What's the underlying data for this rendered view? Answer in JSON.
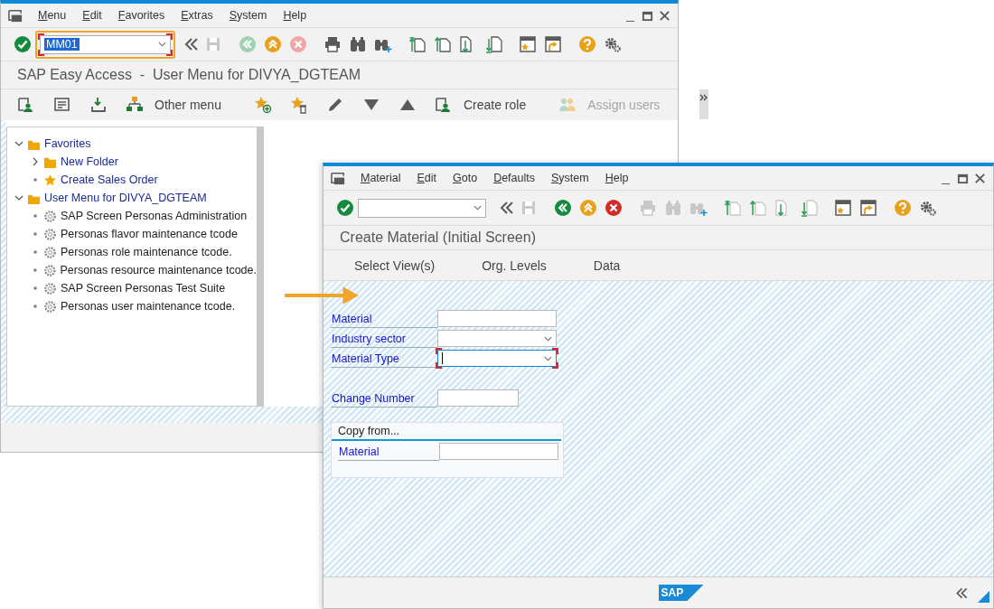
{
  "window_main": {
    "menu": [
      "Menu",
      "Edit",
      "Favorites",
      "Extras",
      "System",
      "Help"
    ],
    "command_field": {
      "value": "MM01",
      "focused": true
    },
    "title": "SAP Easy Access  -  User Menu for DIVYA_DGTEAM",
    "app_toolbar": [
      {
        "label": "Other menu",
        "disabled": false
      },
      {
        "label": "Create role",
        "disabled": false
      },
      {
        "label": "Assign users",
        "disabled": true
      }
    ],
    "tree": [
      {
        "label": "Favorites",
        "kind": "folder",
        "expanded": true,
        "children": [
          {
            "label": "New Folder",
            "kind": "folder",
            "expanded": false
          },
          {
            "label": "Create Sales Order",
            "kind": "favorite"
          }
        ]
      },
      {
        "label": "User Menu for DIVYA_DGTEAM",
        "kind": "folder",
        "expanded": true,
        "children": [
          {
            "label": "SAP Screen Personas Administration",
            "kind": "transaction"
          },
          {
            "label": "Personas flavor maintenance tcode",
            "kind": "transaction"
          },
          {
            "label": "Personas role maintenance tcode.",
            "kind": "transaction"
          },
          {
            "label": "Personas resource maintenance tcode.",
            "kind": "transaction"
          },
          {
            "label": "SAP Screen Personas Test Suite",
            "kind": "transaction"
          },
          {
            "label": "Personas user maintenance tcode.",
            "kind": "transaction"
          }
        ]
      }
    ]
  },
  "window_material": {
    "menu": [
      "Material",
      "Edit",
      "Goto",
      "Defaults",
      "System",
      "Help"
    ],
    "command_field": {
      "focused": false
    },
    "title": "Create Material (Initial Screen)",
    "app_toolbar": [
      {
        "label": "Select View(s)",
        "disabled": false
      },
      {
        "label": "Org. Levels",
        "disabled": false
      },
      {
        "label": "Data",
        "disabled": false
      }
    ],
    "field_groups": [
      [
        {
          "label": "Material",
          "kind": "input",
          "focused": false
        },
        {
          "label": "Industry sector",
          "kind": "dropdown",
          "focused": false
        },
        {
          "label": "Material Type",
          "kind": "dropdown",
          "focused": true
        }
      ],
      [
        {
          "label": "Change Number",
          "kind": "short-input",
          "focused": false
        }
      ]
    ],
    "copy_from": {
      "title": "Copy from...",
      "fields": [
        {
          "label": "Material",
          "kind": "input",
          "focused": false
        }
      ]
    },
    "logo": "SAP"
  }
}
